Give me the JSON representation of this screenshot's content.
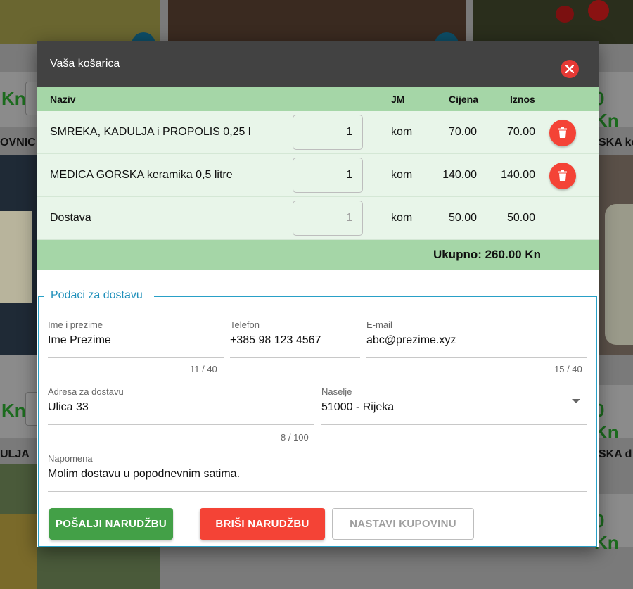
{
  "background": {
    "prices": [
      "Kn",
      "Kn",
      "Kn",
      "0 Kn",
      "0 Kn",
      "0 Kn"
    ],
    "product_names": [
      "OVNIC",
      "ULJA",
      "SKA ke",
      "SKA d"
    ]
  },
  "modal": {
    "title": "Vaša košarica",
    "close_icon": "close-circle-icon"
  },
  "cart": {
    "columns": {
      "name": "Naziv",
      "unit": "JM",
      "price": "Cijena",
      "amount": "Iznos"
    },
    "items": [
      {
        "name": "SMREKA, KADULJA i PROPOLIS 0,25 l",
        "qty": "1",
        "unit": "kom",
        "price": "70.00",
        "amount": "70.00",
        "delete_icon": "trash-icon"
      },
      {
        "name": "MEDICA GORSKA keramika 0,5 litre",
        "qty": "1",
        "unit": "kom",
        "price": "140.00",
        "amount": "140.00",
        "delete_icon": "trash-icon"
      },
      {
        "name": "Dostava",
        "qty": "1",
        "unit": "kom",
        "price": "50.00",
        "amount": "50.00"
      }
    ],
    "total": "Ukupno: 260.00 Kn"
  },
  "delivery": {
    "legend": "Podaci za dostavu",
    "name": {
      "label": "Ime i prezime",
      "value": "Ime Prezime",
      "counter": "11 / 40"
    },
    "phone": {
      "label": "Telefon",
      "value": "+385 98 123 4567"
    },
    "email": {
      "label": "E-mail",
      "value": "abc@prezime.xyz",
      "counter": "15 / 40"
    },
    "address": {
      "label": "Adresa za dostavu",
      "value": "Ulica 33",
      "counter": "8 / 100"
    },
    "city": {
      "label": "Naselje",
      "value": "51000 - Rijeka"
    },
    "note": {
      "label": "Napomena",
      "value": "Molim dostavu u popodnevnim satima."
    }
  },
  "actions": {
    "send": "POŠALJI NARUDŽBU",
    "delete": "BRIŠI NARUDŽBU",
    "continue": "NASTAVI KUPOVINU"
  },
  "colors": {
    "header_bg": "#424242",
    "table_header_bg": "#a5d6a7",
    "row_bg": "#e8f5e9",
    "primary_green": "#43a047",
    "danger_red": "#f44336",
    "fieldset_border": "#29a0c7"
  }
}
